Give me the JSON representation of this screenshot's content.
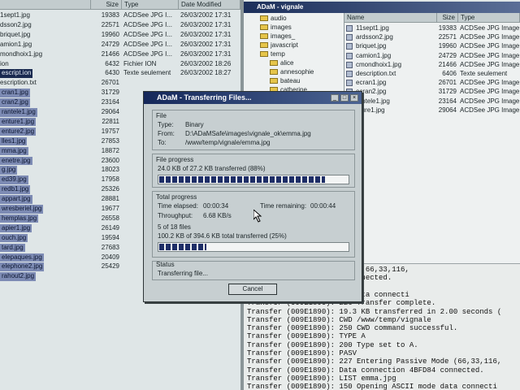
{
  "left_pane": {
    "columns": [
      "Size",
      "Type",
      "Date Modified"
    ],
    "rows": [
      {
        "name": "1sept1.jpg",
        "size": "19383",
        "type": "ACDSee JPG I...",
        "date": "26/03/2002 17:31",
        "sel": ""
      },
      {
        "name": "dsson2.jpg",
        "size": "22571",
        "type": "ACDSee JPG I...",
        "date": "26/03/2002 17:31",
        "sel": ""
      },
      {
        "name": "briquet.jpg",
        "size": "19960",
        "type": "ACDSee JPG I...",
        "date": "26/03/2002 17:31",
        "sel": ""
      },
      {
        "name": "amion1.jpg",
        "size": "24729",
        "type": "ACDSee JPG I...",
        "date": "26/03/2002 17:31",
        "sel": ""
      },
      {
        "name": "mondhoix1.jpg",
        "size": "21466",
        "type": "ACDSee JPG I...",
        "date": "26/03/2002 17:31",
        "sel": ""
      },
      {
        "name": "ion",
        "size": "6432",
        "type": "Fichier ION",
        "date": "26/03/2002 18:26",
        "sel": ""
      },
      {
        "name": "escript.ion",
        "size": "6430",
        "type": "Texte seulement",
        "date": "26/03/2002 18:27",
        "sel": "blk"
      },
      {
        "name": "escription.txt",
        "size": "26701",
        "type": "",
        "date": "",
        "sel": ""
      },
      {
        "name": "cran1.jpg",
        "size": "31729",
        "type": "",
        "date": "",
        "sel": "sel"
      },
      {
        "name": "cran2.jpg",
        "size": "23164",
        "type": "",
        "date": "",
        "sel": "sel"
      },
      {
        "name": "rantele1.jpg",
        "size": "29064",
        "type": "",
        "date": "",
        "sel": "sel"
      },
      {
        "name": "enture1.jpg",
        "size": "22811",
        "type": "",
        "date": "",
        "sel": "sel"
      },
      {
        "name": "enture2.jpg",
        "size": "19757",
        "type": "",
        "date": "",
        "sel": "sel"
      },
      {
        "name": "lles1.jpg",
        "size": "27853",
        "type": "",
        "date": "",
        "sel": "sel"
      },
      {
        "name": "mma.jpg",
        "size": "18872",
        "type": "",
        "date": "",
        "sel": "sel"
      },
      {
        "name": "enetre.jpg",
        "size": "23600",
        "type": "",
        "date": "",
        "sel": "sel"
      },
      {
        "name": "g.jpg",
        "size": "18023",
        "type": "",
        "date": "",
        "sel": "sel"
      },
      {
        "name": "ed39.jpg",
        "size": "17958",
        "type": "",
        "date": "",
        "sel": "sel"
      },
      {
        "name": "redb1.jpg",
        "size": "25326",
        "type": "",
        "date": "",
        "sel": "sel"
      },
      {
        "name": "appart.jpg",
        "size": "28881",
        "type": "",
        "date": "",
        "sel": "sel"
      },
      {
        "name": "wresberiel.jpg",
        "size": "19677",
        "type": "",
        "date": "",
        "sel": "sel"
      },
      {
        "name": "hemplas.jpg",
        "size": "26558",
        "type": "",
        "date": "",
        "sel": "sel"
      },
      {
        "name": "apier1.jpg",
        "size": "26149",
        "type": "",
        "date": "",
        "sel": "sel"
      },
      {
        "name": "ouch.jpg",
        "size": "19594",
        "type": "",
        "date": "",
        "sel": "sel"
      },
      {
        "name": "tard.jpg",
        "size": "27683",
        "type": "",
        "date": "",
        "sel": "sel"
      },
      {
        "name": "elepaques.jpg",
        "size": "20409",
        "type": "",
        "date": "",
        "sel": "sel"
      },
      {
        "name": "elephone2.jpg",
        "size": "25429",
        "type": "",
        "date": "",
        "sel": "sel"
      },
      {
        "name": "rahout2.jpg",
        "size": "",
        "type": "",
        "date": "",
        "sel": "sel"
      }
    ]
  },
  "right_window": {
    "title": "ADaM - vignale",
    "folders": [
      "audio",
      "images",
      "images_",
      "javascript",
      "temp",
      "alice",
      "annesophie",
      "bateau",
      "catherine"
    ],
    "columns": [
      "Name",
      "Size",
      "Type"
    ],
    "rows": [
      {
        "name": "11sept1.jpg",
        "size": "19383",
        "type": "ACDSee JPG Image"
      },
      {
        "name": "ardsson2.jpg",
        "size": "22571",
        "type": "ACDSee JPG Image"
      },
      {
        "name": "briquet.jpg",
        "size": "19960",
        "type": "ACDSee JPG Image"
      },
      {
        "name": "camion1.jpg",
        "size": "24729",
        "type": "ACDSee JPG Image"
      },
      {
        "name": "cmondhoix1.jpg",
        "size": "21466",
        "type": "ACDSee JPG Image"
      },
      {
        "name": "description.txt",
        "size": "6406",
        "type": "Texte seulement"
      },
      {
        "name": "ecran1.jpg",
        "size": "26701",
        "type": "ACDSee JPG Image"
      },
      {
        "name": "ecran2.jpg",
        "size": "31729",
        "type": "ACDSee JPG Image"
      },
      {
        "name": "rantele1.jpg",
        "size": "23164",
        "type": "ACDSee JPG Image"
      },
      {
        "name": "nture1.jpg",
        "size": "29064",
        "type": "ACDSee JPG Image"
      }
    ]
  },
  "log": [
    "227 Entering Passive Mode (66,33,116,",
    "Data connection 4BFD84 connected.",
    "RETR elles1.jpg",
    "150 Opening BINARY mode data connecti",
    "Transfer (009E1890): 226 Transfer complete.",
    "Transfer (009E1890): 19.3 KB transferred in 2.00 seconds (",
    "Transfer (009E1890): CWD /www/temp/vignale",
    "Transfer (009E1890): 250 CWD command successful.",
    "Transfer (009E1890): TYPE A",
    "Transfer (009E1890): 200 Type set to A.",
    "Transfer (009E1890): PASV",
    "Transfer (009E1890): 227 Entering Passive Mode (66,33,116,",
    "Transfer (009E1890): Data connection 4BFD84 connected.",
    "Transfer (009E1890): LIST emma.jpg",
    "Transfer (009E1890): 150 Opening ASCII mode data connecti"
  ],
  "dialog": {
    "title": "ADaM - Transferring Files...",
    "file_group": "File",
    "type_label": "Type:",
    "type_value": "Binary",
    "from_label": "From:",
    "from_value": "D:\\ADaMSafe\\images\\vignale_ok\\emma.jpg",
    "to_label": "To:",
    "to_value": "/www/temp/vignale/emma.jpg",
    "fp_group": "File progress",
    "fp_text": "24.0 KB of 27.2 KB transferred (88%)",
    "fp_fraction": 0.88,
    "tp_group": "Total progress",
    "elapsed_label": "Time elapsed:",
    "elapsed_value": "00:00:34",
    "remaining_label": "Time remaining:",
    "remaining_value": "00:00:44",
    "throughput_label": "Throughput:",
    "throughput_value": "6.68 KB/s",
    "files_text": "5 of 18 files",
    "tp_text": "100.2 KB of 394.6 KB total transferred (25%)",
    "tp_fraction": 0.25,
    "status_group": "Status",
    "status_text": "Transferring file...",
    "cancel": "Cancel"
  }
}
